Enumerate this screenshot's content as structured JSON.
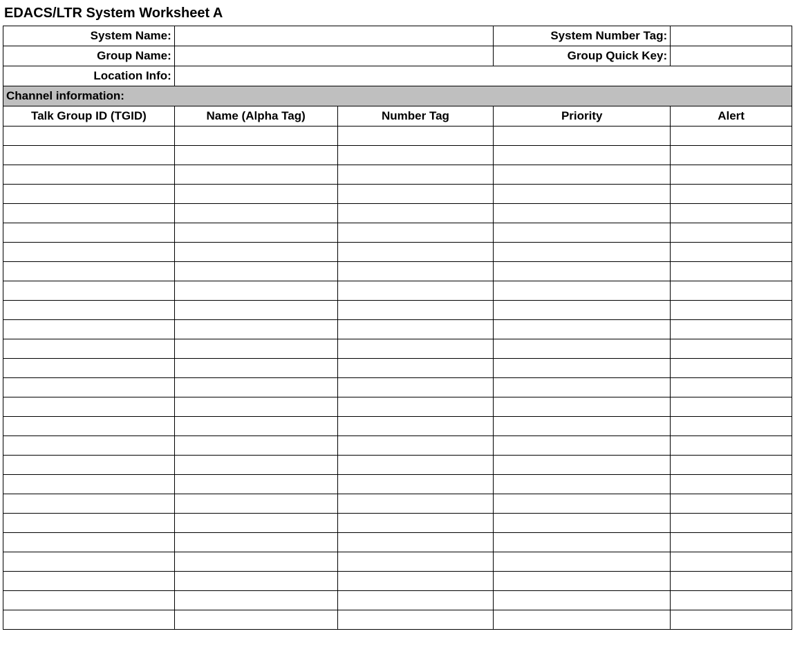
{
  "title": "EDACS/LTR System Worksheet A",
  "header": {
    "system_name_label": "System Name:",
    "system_name_value": "",
    "system_number_tag_label": "System Number Tag:",
    "system_number_tag_value": "",
    "group_name_label": "Group Name:",
    "group_name_value": "",
    "group_quick_key_label": "Group Quick Key:",
    "group_quick_key_value": "",
    "location_info_label": "Location Info:",
    "location_info_value": ""
  },
  "section_header": "Channel information:",
  "columns": {
    "tgid": "Talk Group ID (TGID)",
    "name": "Name (Alpha Tag)",
    "number_tag": "Number Tag",
    "priority": "Priority",
    "alert": "Alert"
  },
  "rows": [
    {
      "tgid": "",
      "name": "",
      "number_tag": "",
      "priority": "",
      "alert": ""
    },
    {
      "tgid": "",
      "name": "",
      "number_tag": "",
      "priority": "",
      "alert": ""
    },
    {
      "tgid": "",
      "name": "",
      "number_tag": "",
      "priority": "",
      "alert": ""
    },
    {
      "tgid": "",
      "name": "",
      "number_tag": "",
      "priority": "",
      "alert": ""
    },
    {
      "tgid": "",
      "name": "",
      "number_tag": "",
      "priority": "",
      "alert": ""
    },
    {
      "tgid": "",
      "name": "",
      "number_tag": "",
      "priority": "",
      "alert": ""
    },
    {
      "tgid": "",
      "name": "",
      "number_tag": "",
      "priority": "",
      "alert": ""
    },
    {
      "tgid": "",
      "name": "",
      "number_tag": "",
      "priority": "",
      "alert": ""
    },
    {
      "tgid": "",
      "name": "",
      "number_tag": "",
      "priority": "",
      "alert": ""
    },
    {
      "tgid": "",
      "name": "",
      "number_tag": "",
      "priority": "",
      "alert": ""
    },
    {
      "tgid": "",
      "name": "",
      "number_tag": "",
      "priority": "",
      "alert": ""
    },
    {
      "tgid": "",
      "name": "",
      "number_tag": "",
      "priority": "",
      "alert": ""
    },
    {
      "tgid": "",
      "name": "",
      "number_tag": "",
      "priority": "",
      "alert": ""
    },
    {
      "tgid": "",
      "name": "",
      "number_tag": "",
      "priority": "",
      "alert": ""
    },
    {
      "tgid": "",
      "name": "",
      "number_tag": "",
      "priority": "",
      "alert": ""
    },
    {
      "tgid": "",
      "name": "",
      "number_tag": "",
      "priority": "",
      "alert": ""
    },
    {
      "tgid": "",
      "name": "",
      "number_tag": "",
      "priority": "",
      "alert": ""
    },
    {
      "tgid": "",
      "name": "",
      "number_tag": "",
      "priority": "",
      "alert": ""
    },
    {
      "tgid": "",
      "name": "",
      "number_tag": "",
      "priority": "",
      "alert": ""
    },
    {
      "tgid": "",
      "name": "",
      "number_tag": "",
      "priority": "",
      "alert": ""
    },
    {
      "tgid": "",
      "name": "",
      "number_tag": "",
      "priority": "",
      "alert": ""
    },
    {
      "tgid": "",
      "name": "",
      "number_tag": "",
      "priority": "",
      "alert": ""
    },
    {
      "tgid": "",
      "name": "",
      "number_tag": "",
      "priority": "",
      "alert": ""
    },
    {
      "tgid": "",
      "name": "",
      "number_tag": "",
      "priority": "",
      "alert": ""
    },
    {
      "tgid": "",
      "name": "",
      "number_tag": "",
      "priority": "",
      "alert": ""
    },
    {
      "tgid": "",
      "name": "",
      "number_tag": "",
      "priority": "",
      "alert": ""
    }
  ]
}
